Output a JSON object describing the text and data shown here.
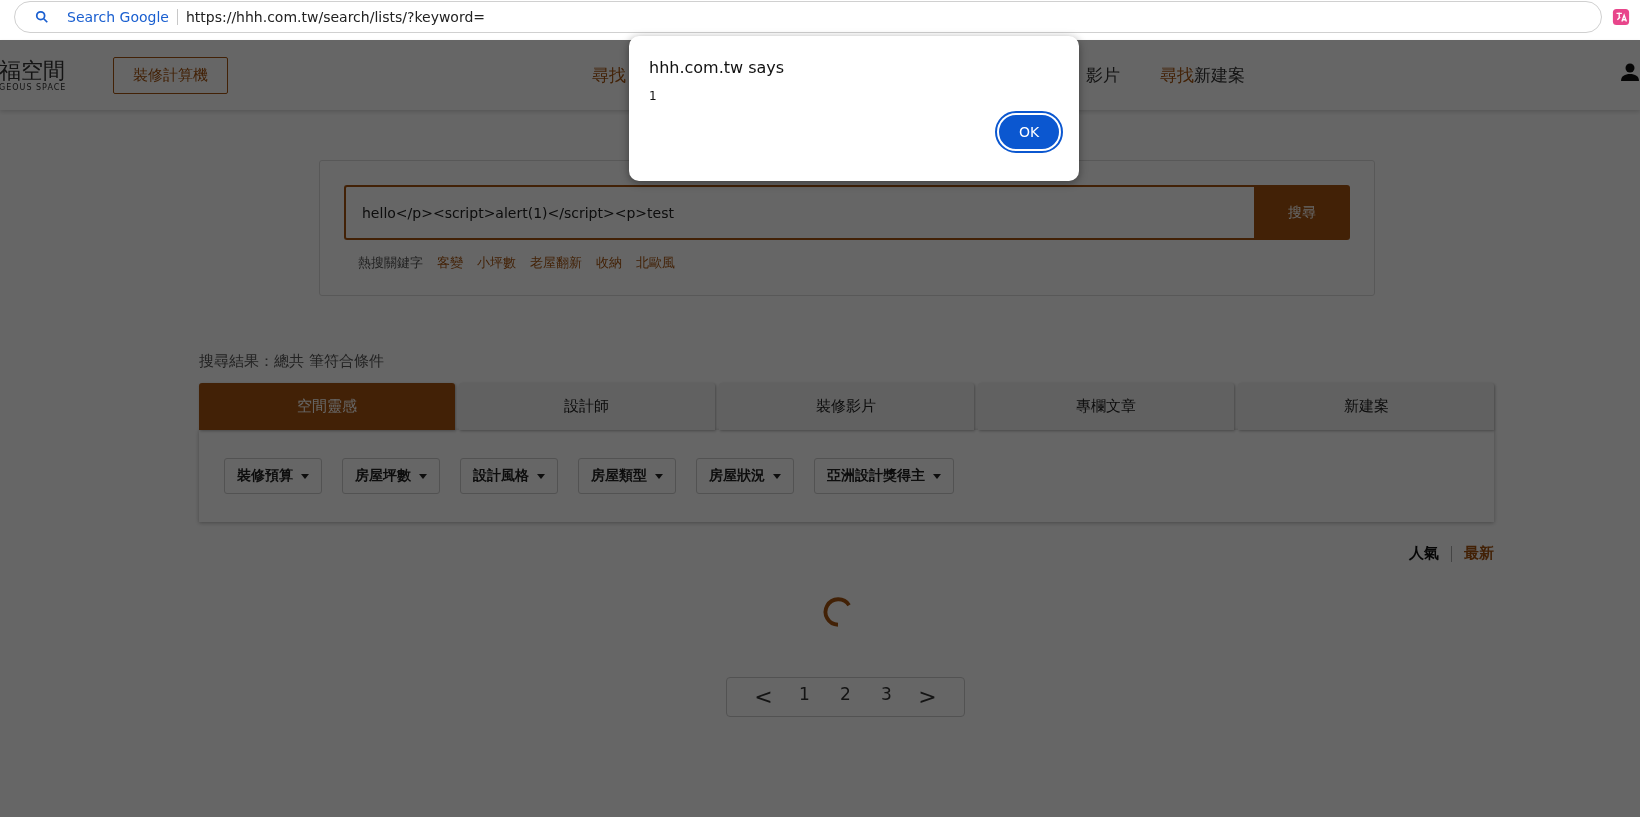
{
  "browser": {
    "search_label": "Search Google",
    "url": "https://hhh.com.tw/search/lists/?keyword="
  },
  "header": {
    "logo": "福空間",
    "logo_sub": "GEOUS SPACE",
    "calc_button": "裝修計算機",
    "nav": [
      {
        "accent": "尋找"
      },
      {
        "text": "影片"
      },
      {
        "accent": "尋找",
        "text": "新建案"
      }
    ]
  },
  "dialog": {
    "title": "hhh.com.tw says",
    "message": "1",
    "button": "OK"
  },
  "search": {
    "value": "hello</p><script>alert(1)</script><p>test",
    "button": "搜尋",
    "hot_label": "熱搜關鍵字",
    "hot_keywords": [
      "客變",
      "小坪數",
      "老屋翻新",
      "收納",
      "北歐風"
    ]
  },
  "result_summary": "搜尋結果：總共 筆符合條件",
  "tabs": [
    {
      "label": "空間靈感",
      "selected": true
    },
    {
      "label": "設計師",
      "selected": false
    },
    {
      "label": "裝修影片",
      "selected": false
    },
    {
      "label": "專欄文章",
      "selected": false
    },
    {
      "label": "新建案",
      "selected": false
    }
  ],
  "filters": [
    "裝修預算",
    "房屋坪數",
    "設計風格",
    "房屋類型",
    "房屋狀況",
    "亞洲設計獎得主"
  ],
  "sort": [
    {
      "label": "人氣",
      "selected": false
    },
    {
      "label": "最新",
      "selected": true
    }
  ],
  "pagination": {
    "prev": "<",
    "pages": [
      "1",
      "2",
      "3"
    ],
    "next": ">"
  }
}
